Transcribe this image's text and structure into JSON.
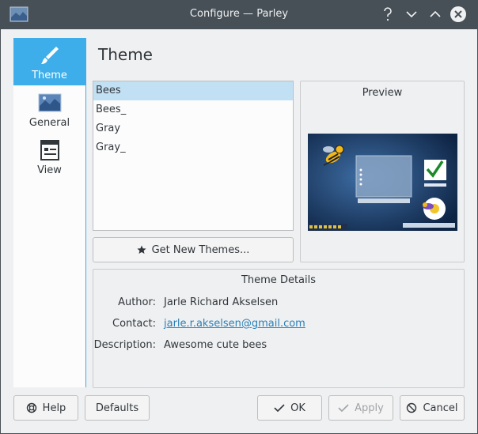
{
  "window": {
    "title": "Configure — Parley"
  },
  "sidebar": {
    "items": [
      {
        "label": "Theme",
        "icon": "brush-icon",
        "active": true
      },
      {
        "label": "General",
        "icon": "general-icon",
        "active": false
      },
      {
        "label": "View",
        "icon": "view-icon",
        "active": false
      }
    ]
  },
  "page": {
    "title": "Theme"
  },
  "themes": {
    "items": [
      "Bees",
      "Bees_",
      "Gray",
      "Gray_"
    ],
    "selected": "Bees"
  },
  "get_new_button": {
    "label": "Get New Themes..."
  },
  "preview": {
    "title": "Preview"
  },
  "details": {
    "title": "Theme Details",
    "author_label": "Author:",
    "author": "Jarle Richard Akselsen",
    "contact_label": "Contact:",
    "contact": "jarle.r.akselsen@gmail.com",
    "description_label": "Description:",
    "description": "Awesome cute bees"
  },
  "buttons": {
    "help": "Help",
    "defaults": "Defaults",
    "ok": "OK",
    "apply": "Apply",
    "cancel": "Cancel"
  },
  "colors": {
    "accent": "#3daee9",
    "titlebar": "#475057",
    "selection": "#c2e0f4",
    "link": "#2980b9"
  }
}
